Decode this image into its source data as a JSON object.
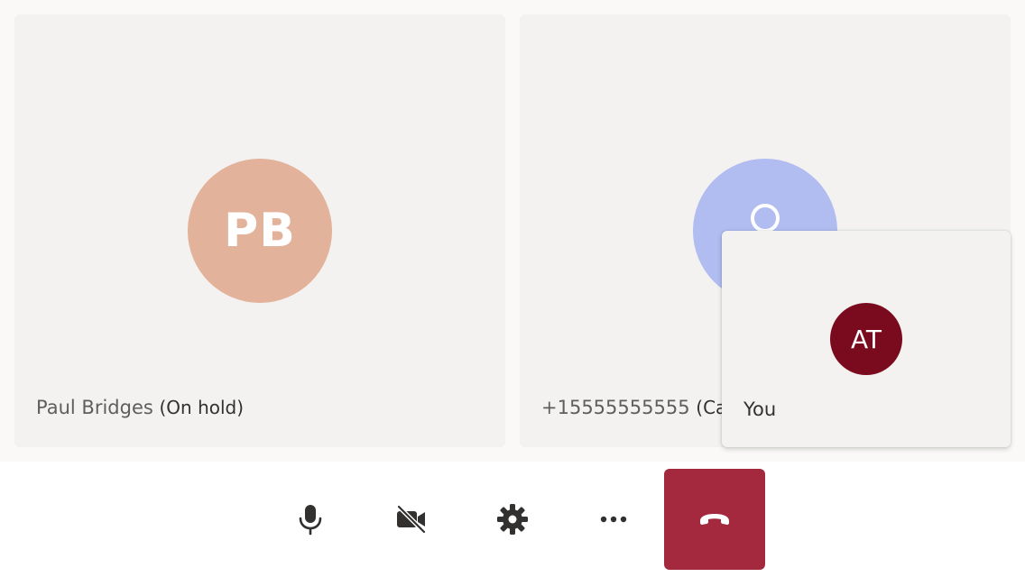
{
  "participants": [
    {
      "initials": "PB",
      "name": "Paul Bridges",
      "status": "(On hold)",
      "avatar_color": "#e3b29a",
      "initials_color": "#ffffff"
    },
    {
      "name": "+15555555555",
      "status": "(Calling...)",
      "avatar_color": "#b1bcf0",
      "icon_color": "#ffffff",
      "icon": "person-icon"
    }
  ],
  "self_view": {
    "initials": "AT",
    "label": "You",
    "avatar_color": "#7a0a1d",
    "initials_color": "#ffffff"
  },
  "controls": {
    "icon_color": "#323130",
    "hangup_color": "#a4293f",
    "hangup_icon_color": "#ffffff",
    "items": [
      {
        "icon": "microphone-icon"
      },
      {
        "icon": "camera-off-icon"
      },
      {
        "icon": "settings-gear-icon"
      },
      {
        "icon": "more-options-icon"
      },
      {
        "icon": "hang-up-icon"
      }
    ]
  }
}
